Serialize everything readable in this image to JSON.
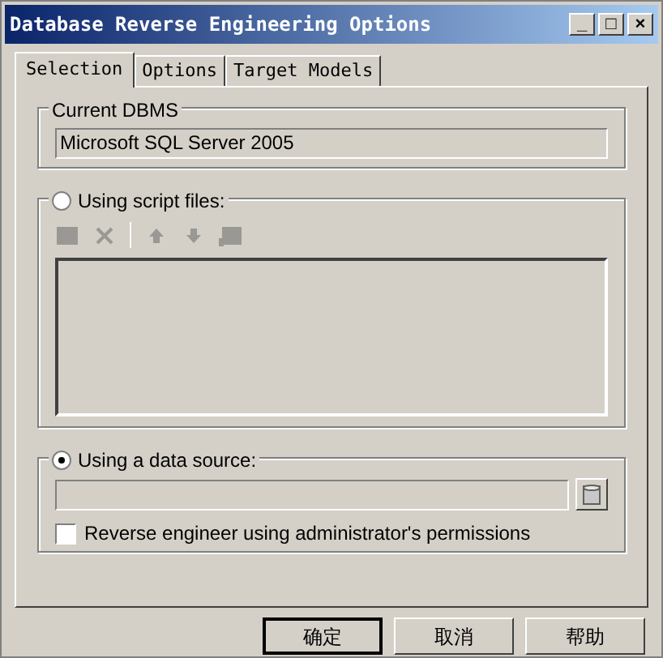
{
  "window": {
    "title": "Database Reverse Engineering Options"
  },
  "title_buttons": [
    "_",
    "□",
    "×"
  ],
  "tabs": [
    {
      "label": "Selection",
      "selected": true
    },
    {
      "label": "Options",
      "selected": false
    },
    {
      "label": "Target Models",
      "selected": false
    }
  ],
  "current_dbms": {
    "label": "Current DBMS",
    "value": "Microsoft SQL Server 2005"
  },
  "sources": [
    {
      "kind": "script",
      "label": "Using script files:",
      "selected": false,
      "toolbar_disabled": true
    },
    {
      "kind": "datasource",
      "label": "Using a data source:",
      "selected": true,
      "checkbox": {
        "label": "Reverse engineer using administrator's permissions",
        "checked": false
      }
    }
  ],
  "buttons": [
    "确定",
    "取消",
    "帮助"
  ]
}
